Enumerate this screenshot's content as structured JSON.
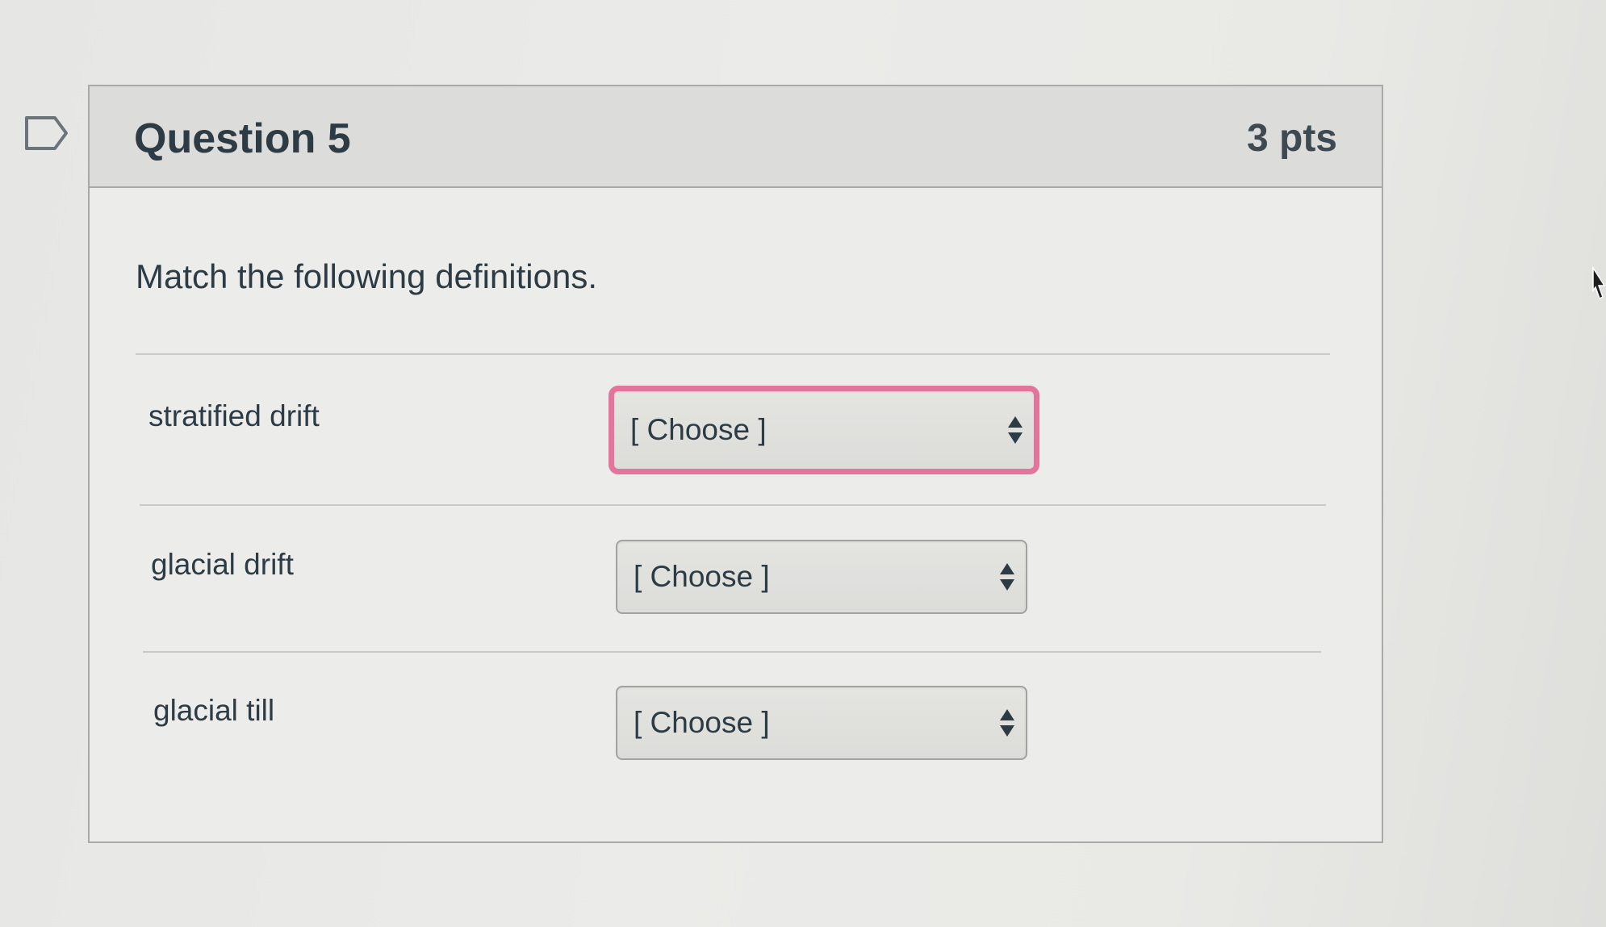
{
  "question": {
    "title": "Question 5",
    "points": "3 pts",
    "prompt": "Match the following definitions."
  },
  "rows": [
    {
      "label": "stratified drift",
      "selected": "[ Choose ]",
      "focused": true
    },
    {
      "label": "glacial drift",
      "selected": "[ Choose ]",
      "focused": false
    },
    {
      "label": "glacial till",
      "selected": "[ Choose ]",
      "focused": false
    }
  ],
  "colors": {
    "focus_ring": "#e3759c",
    "text": "#2d3b45",
    "header_bg": "#dcdcda"
  },
  "icons": {
    "flag": "flag-question-icon",
    "select_arrows": "select-updown-arrows-icon",
    "cursor": "mouse-pointer-icon"
  }
}
